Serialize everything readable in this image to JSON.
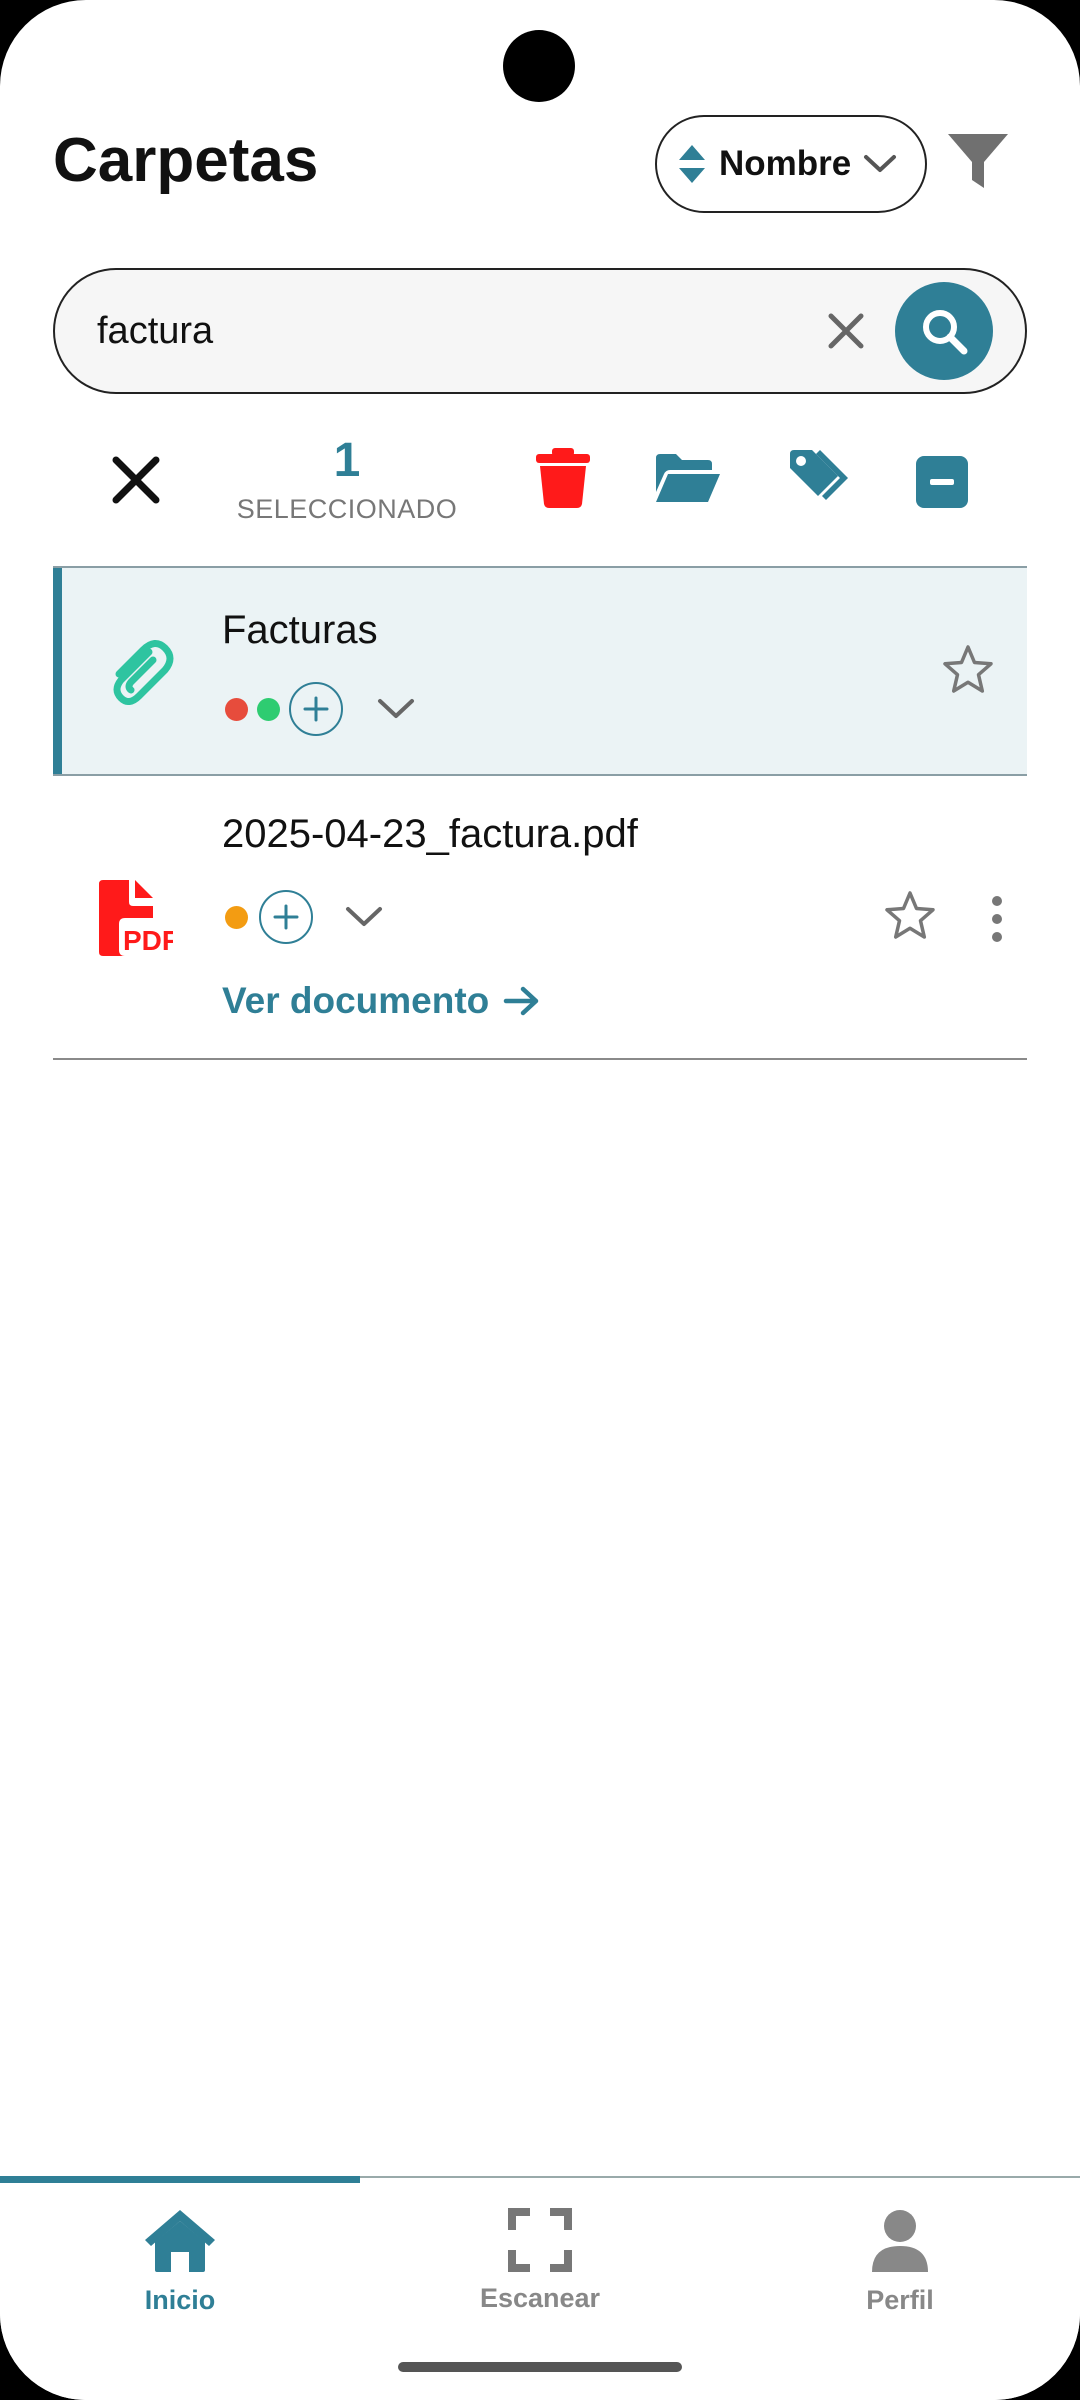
{
  "header": {
    "title": "Carpetas",
    "sort_label": "Nombre",
    "sort_icon": "sort-updown-icon",
    "filter_icon": "filter-icon"
  },
  "search": {
    "value": "factura",
    "clear_icon": "close-icon",
    "search_icon": "search-icon"
  },
  "selection_toolbar": {
    "count": "1",
    "label": "SELECCIONADO",
    "actions": [
      "close-icon",
      "trash-icon",
      "folder-open-icon",
      "tags-icon",
      "minus-square-icon"
    ]
  },
  "items": [
    {
      "title": "Facturas",
      "icon": "paperclip-icon",
      "selected": true,
      "tag_colors": [
        "#e74c3c",
        "#2ecc71"
      ],
      "favorite": false
    },
    {
      "title": "2025-04-23_factura.pdf",
      "icon": "pdf-icon",
      "selected": false,
      "tag_colors": [
        "#f39c12"
      ],
      "favorite": false,
      "link_label": "Ver documento"
    }
  ],
  "bottom_nav": {
    "items": [
      {
        "label": "Inicio",
        "icon": "home-icon",
        "active": true
      },
      {
        "label": "Escanear",
        "icon": "scan-icon",
        "active": false
      },
      {
        "label": "Perfil",
        "icon": "user-icon",
        "active": false
      }
    ]
  },
  "colors": {
    "accent": "#2f7f96",
    "danger": "#ff1a1a",
    "selected_row_bg": "#ebf3f5",
    "paperclip": "#2ec4a0",
    "pdf": "#ff1a1a"
  }
}
